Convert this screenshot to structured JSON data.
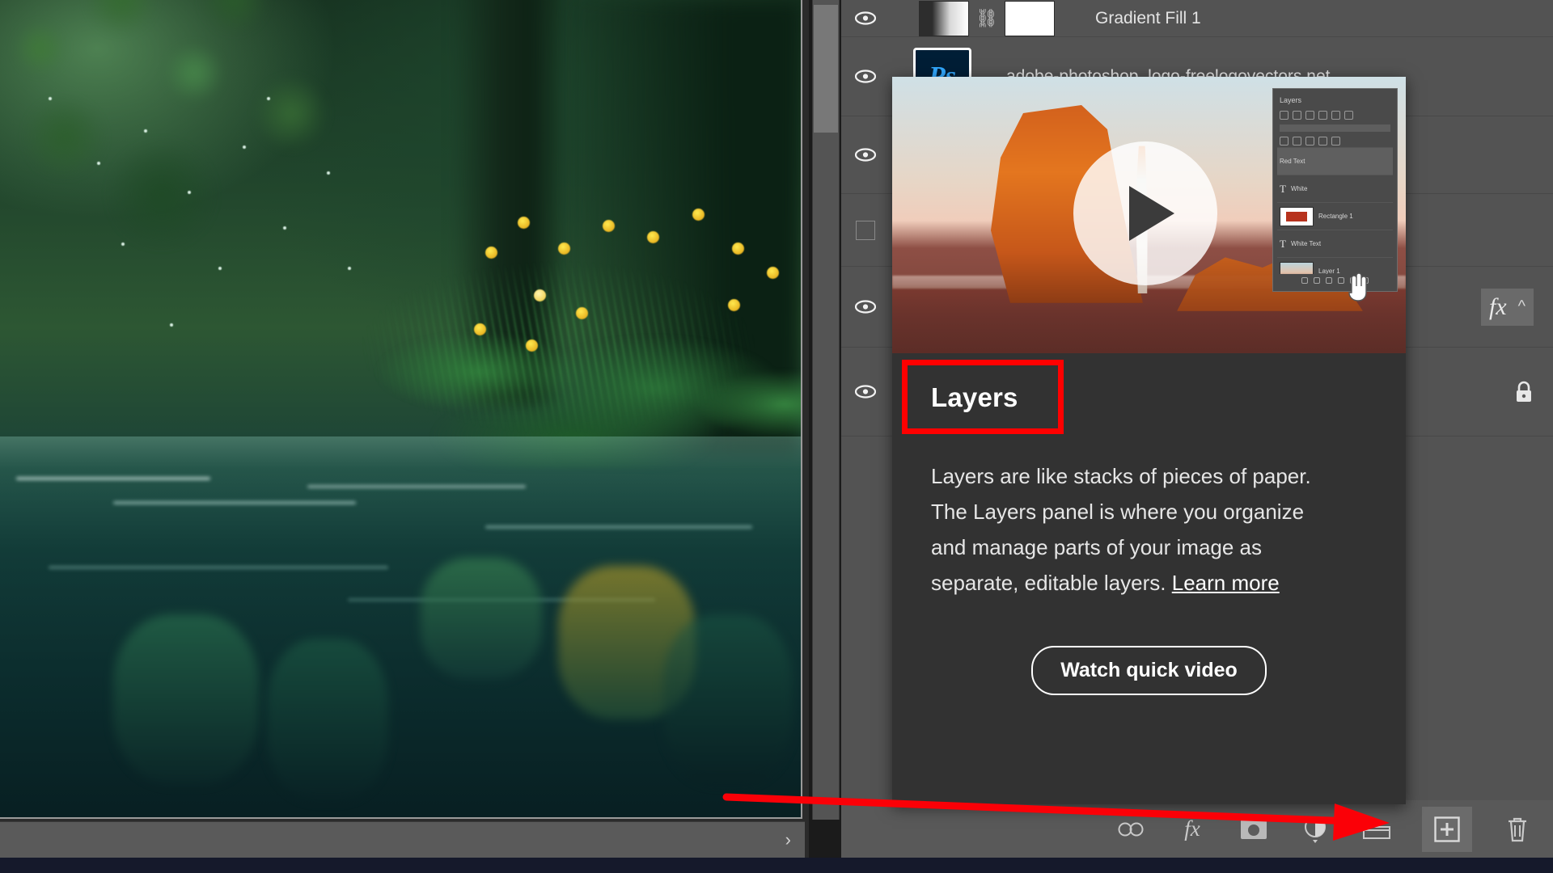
{
  "app": {
    "name": "Adobe Photoshop",
    "panel_title": "Layers"
  },
  "layers": [
    {
      "name": "Gradient Fill 1",
      "visible": true,
      "thumb": "gradient-swatch",
      "mask": "white-mask",
      "linked": true
    },
    {
      "name": "adobe-photoshop_logo-freelogovectors.net",
      "visible": true,
      "thumb": "ps-logo"
    },
    {
      "name": "",
      "visible": true,
      "thumb": ""
    },
    {
      "name": "",
      "visible": false,
      "thumb": ""
    },
    {
      "name": "",
      "visible": true,
      "thumb": "",
      "effects": "fx"
    },
    {
      "name": "",
      "visible": true,
      "thumb": "",
      "locked": true
    }
  ],
  "layer_row_badges": {
    "fx_label": "fx",
    "collapse_chevron": "^",
    "lock_icon": "lock-icon"
  },
  "panel_toolbar": {
    "buttons": [
      {
        "name": "link-layers",
        "icon": "link-icon"
      },
      {
        "name": "add-layer-style",
        "icon": "fx-icon"
      },
      {
        "name": "add-layer-mask",
        "icon": "mask-icon"
      },
      {
        "name": "new-fill-adjustment-layer",
        "icon": "half-circle-icon"
      },
      {
        "name": "new-group",
        "icon": "folder-icon"
      },
      {
        "name": "new-layer",
        "icon": "plus-square-icon"
      },
      {
        "name": "delete-layer",
        "icon": "trash-icon"
      }
    ]
  },
  "coachmark": {
    "heading": "Layers",
    "body_lines": [
      "Layers are like stacks of pieces of",
      "paper. The Layers panel is where",
      "you organize and manage parts of",
      "your image as separate, editable",
      "layers."
    ],
    "body": "Layers are like stacks of pieces of paper. The Layers panel is where you organize and manage parts of your image as separate, editable layers.",
    "learn_more_label": "Learn more",
    "cta_label": "Watch quick video",
    "video": {
      "play_icon": "play-icon",
      "mini_panel_title": "Layers",
      "mini_rows": [
        {
          "label": "Red Text"
        },
        {
          "label": "White"
        },
        {
          "label": "Rectangle 1"
        },
        {
          "label": "White Text"
        },
        {
          "label": "Layer 1"
        }
      ]
    }
  },
  "canvas": {
    "scroll_chevron": "›"
  },
  "colors": {
    "panel_bg": "#535353",
    "popup_bg": "#323232",
    "highlight_red": "#ff0000",
    "accent_blue": "#31a8ff",
    "text_primary": "#ffffff",
    "text_secondary": "#e6e6e6"
  }
}
